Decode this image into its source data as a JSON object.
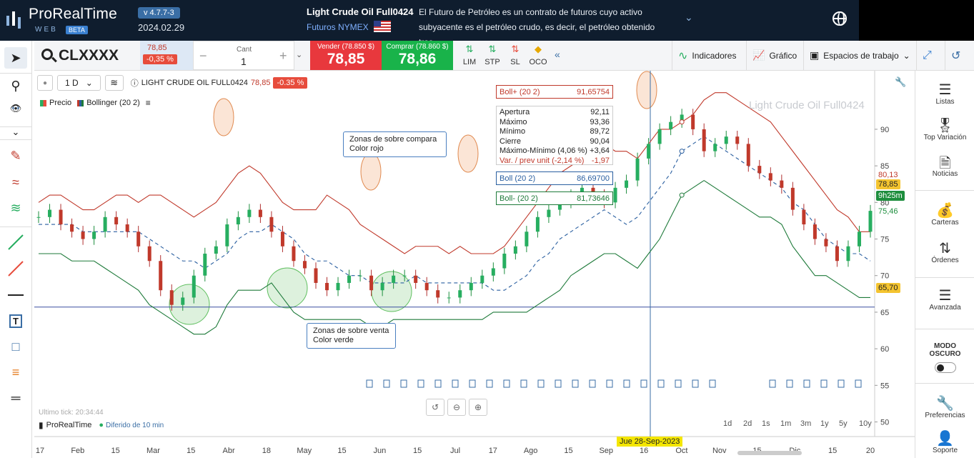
{
  "app": {
    "name": "ProRealTime",
    "sub": "WEB",
    "beta": "BETA",
    "version": "v 4.7.7-3",
    "date": "2024.02.29"
  },
  "instrument": {
    "name": "Light Crude Oil Full0424",
    "exchange": "Futuros NYMEX",
    "description": "El Futuro de Petróleo es un contrato de futuros cuyo activo subyacente es el petróleo crudo, es decir, el petróleo obtenido tras..."
  },
  "order": {
    "ticker": "CLXXXX",
    "last_price": "78,85",
    "change": "-0,35 %",
    "qty_label": "Cant",
    "qty_value": "1",
    "sell_label": "Vender (78.850 $)",
    "sell_price": "78,85",
    "buy_label": "Comprar (78.860 $)",
    "buy_price": "78,86",
    "types": [
      "LIM",
      "STP",
      "SL",
      "OCO"
    ]
  },
  "toolbar": {
    "indicators": "Indicadores",
    "chart": "Gráfico",
    "workspaces": "Espacios de trabajo"
  },
  "chart": {
    "period": "1 D",
    "title": "LIGHT CRUDE OIL FULL0424",
    "title_price": "78,85",
    "title_change": "-0.35 %",
    "legend": [
      {
        "label": "Precio"
      },
      {
        "label": "Bollinger (20 2)"
      }
    ],
    "watermark": "Light Crude Oil Full0424",
    "last_tick": "Ultimo tick: 20:34:44",
    "brand": "ProRealTime",
    "delay": "Diferido de 10 min",
    "cursor_date": "Jue 28-Sep-2023",
    "timeframes": [
      "1d",
      "2d",
      "1s",
      "1m",
      "3m",
      "1y",
      "5y",
      "10y"
    ],
    "notes": {
      "buy_zone": {
        "line1": "Zonas de sobre compara",
        "line2": "Color rojo"
      },
      "sell_zone": {
        "line1": "Zonas de sobre venta",
        "line2": "Color verde"
      }
    },
    "boll_upper": {
      "label": "Boll+ (20 2)",
      "value": "91,65754"
    },
    "boll_mid": {
      "label": "Boll (20 2)",
      "value": "86,69700"
    },
    "boll_lower": {
      "label": "Boll- (20 2)",
      "value": "81,73646"
    },
    "ohlc": [
      {
        "label": "Apertura",
        "value": "92,11"
      },
      {
        "label": "Máximo",
        "value": "93,36"
      },
      {
        "label": "Mínimo",
        "value": "89,72"
      },
      {
        "label": "Cierre",
        "value": "90,04"
      },
      {
        "label": "Máximo-Mínimo (4,06 %)",
        "value": "+3,64"
      },
      {
        "label": "Var. / prev unit (-2,14 %)",
        "value": "-1,97"
      }
    ],
    "price_tags": {
      "upper": "80,13",
      "last": "78,85",
      "countdown": "9h25m",
      "mid": "75,46",
      "hline": "65,70"
    }
  },
  "chart_data": {
    "type": "line",
    "title": "",
    "xlabel": "",
    "ylabel": "",
    "ylim": [
      48,
      98
    ],
    "y_ticks": [
      50,
      55,
      60,
      65,
      70,
      75,
      80,
      85,
      90
    ],
    "x_ticks": [
      "17",
      "Feb",
      "15",
      "Mar",
      "15",
      "Abr",
      "18",
      "May",
      "15",
      "Jun",
      "15",
      "Jul",
      "17",
      "Ago",
      "15",
      "Sep",
      "16",
      "Oct",
      "Nov",
      "15",
      "Dic",
      "15",
      "20"
    ],
    "series": [
      {
        "name": "Boll+ (20 2)",
        "values": [
          80,
          81,
          81,
          80,
          79,
          79,
          80,
          81,
          81,
          80,
          81,
          81,
          80,
          79,
          78,
          79,
          80,
          82,
          84,
          85,
          84,
          82,
          80,
          79,
          79,
          79,
          81,
          80,
          79,
          77,
          76,
          75,
          74,
          73,
          74,
          74,
          74,
          73,
          74,
          73,
          73,
          73,
          74,
          76,
          78,
          80,
          82,
          84,
          85,
          86,
          87,
          88,
          87,
          87,
          86,
          88,
          90,
          90,
          91,
          92,
          94,
          95,
          95,
          94,
          93,
          92,
          91,
          89,
          87,
          85,
          83,
          81,
          79,
          78,
          76,
          76
        ]
      },
      {
        "name": "Boll (20 2)",
        "values": [
          77,
          77,
          77,
          77,
          76,
          76,
          76,
          76,
          76,
          76,
          75,
          74,
          73,
          72,
          72,
          71,
          72,
          73,
          75,
          76,
          76,
          77,
          76,
          75,
          73,
          72,
          72,
          71,
          70,
          70,
          69,
          69,
          69,
          69,
          70,
          69,
          69,
          69,
          69,
          69,
          69,
          68,
          68,
          69,
          70,
          72,
          73,
          75,
          76,
          77,
          78,
          79,
          78,
          77,
          78,
          80,
          82,
          84,
          87,
          88,
          89,
          88,
          87,
          86,
          85,
          84,
          83,
          82,
          80,
          79,
          77,
          75,
          74,
          73,
          73,
          72
        ]
      },
      {
        "name": "Boll- (20 2)",
        "values": [
          73,
          73,
          73,
          72,
          72,
          72,
          71,
          70,
          69,
          68,
          66,
          65,
          64,
          63,
          62,
          62,
          63,
          66,
          68,
          68,
          68,
          69,
          67,
          65,
          64,
          64,
          64,
          64,
          64,
          64,
          63,
          63,
          64,
          64,
          64,
          64,
          64,
          64,
          64,
          64,
          64,
          65,
          65,
          65,
          65,
          66,
          67,
          68,
          70,
          71,
          72,
          73,
          73,
          72,
          71,
          73,
          75,
          78,
          81,
          82,
          83,
          82,
          81,
          80,
          79,
          78,
          78,
          77,
          74,
          72,
          70,
          70,
          69,
          68,
          67,
          67
        ]
      },
      {
        "name": "Precio",
        "values": [
          78,
          79,
          77,
          76,
          75,
          76,
          78,
          77,
          76,
          74,
          72,
          68,
          66,
          67,
          70,
          73,
          74,
          77,
          78,
          79,
          78,
          76,
          74,
          72,
          71,
          69,
          68,
          69,
          70,
          70,
          68,
          69,
          70,
          70,
          69,
          68,
          67,
          67,
          68,
          69,
          70,
          71,
          73,
          74,
          76,
          78,
          79,
          80,
          81,
          82,
          81,
          80,
          82,
          83,
          86,
          88,
          90,
          91,
          92,
          90,
          87,
          88,
          89,
          88,
          85,
          84,
          83,
          82,
          79,
          77,
          75,
          74,
          72,
          74,
          76,
          78.85
        ]
      }
    ]
  },
  "rightpanel": {
    "items": [
      {
        "label": "Listas",
        "icon": "list-icon"
      },
      {
        "label": "Top Variación",
        "icon": "medal-icon"
      },
      {
        "label": "Noticias",
        "icon": "news-icon"
      },
      {
        "label": "Carteras",
        "icon": "wallet-icon"
      },
      {
        "label": "Órdenes",
        "icon": "orders-icon"
      },
      {
        "label": "Avanzada",
        "icon": "layers-icon"
      },
      {
        "label": "Preferencias",
        "icon": "wrench-icon"
      },
      {
        "label": "Soporte",
        "icon": "user-icon"
      }
    ],
    "dark_mode": "MODO OSCURO"
  }
}
